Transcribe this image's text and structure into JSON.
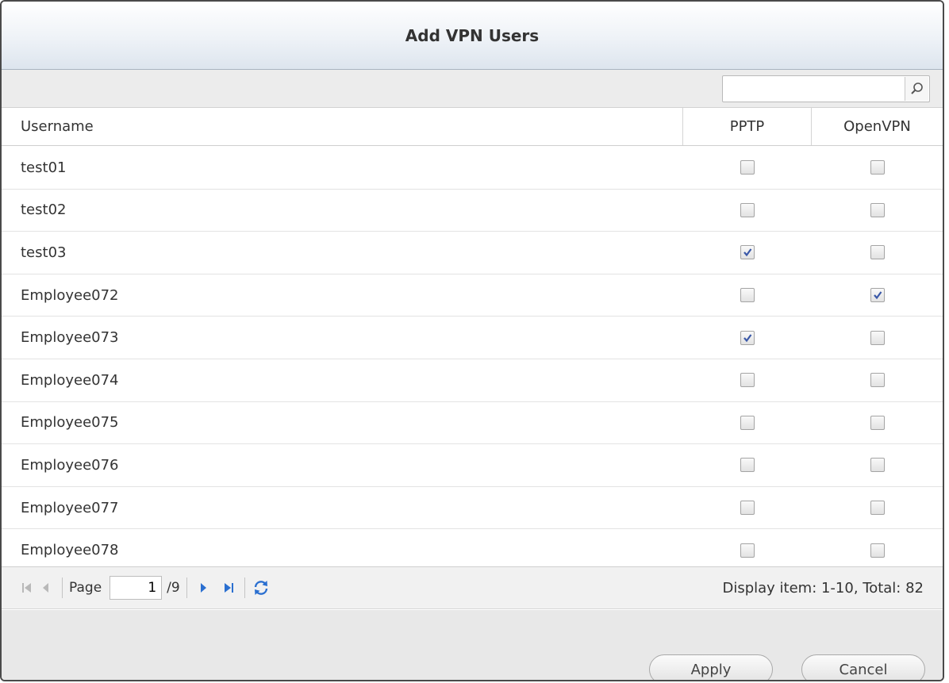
{
  "dialog": {
    "title": "Add VPN Users"
  },
  "search": {
    "value": "",
    "placeholder": "",
    "icon": "search-icon"
  },
  "table": {
    "columns": [
      "Username",
      "PPTP",
      "OpenVPN"
    ],
    "rows": [
      {
        "username": "test01",
        "pptp": false,
        "openvpn": false
      },
      {
        "username": "test02",
        "pptp": false,
        "openvpn": false
      },
      {
        "username": "test03",
        "pptp": true,
        "openvpn": false
      },
      {
        "username": "Employee072",
        "pptp": false,
        "openvpn": true
      },
      {
        "username": "Employee073",
        "pptp": true,
        "openvpn": false
      },
      {
        "username": "Employee074",
        "pptp": false,
        "openvpn": false
      },
      {
        "username": "Employee075",
        "pptp": false,
        "openvpn": false
      },
      {
        "username": "Employee076",
        "pptp": false,
        "openvpn": false
      },
      {
        "username": "Employee077",
        "pptp": false,
        "openvpn": false
      },
      {
        "username": "Employee078",
        "pptp": false,
        "openvpn": false
      }
    ]
  },
  "pager": {
    "page_label": "Page",
    "current_page": "1",
    "total_pages": "/9",
    "display_info": "Display item: 1-10, Total: 82"
  },
  "footer": {
    "apply_label": "Apply",
    "cancel_label": "Cancel"
  },
  "colors": {
    "check_mark": "#3a58a8",
    "nav_arrow": "#2a6fd0",
    "disabled_arrow": "#b8b8b8"
  }
}
